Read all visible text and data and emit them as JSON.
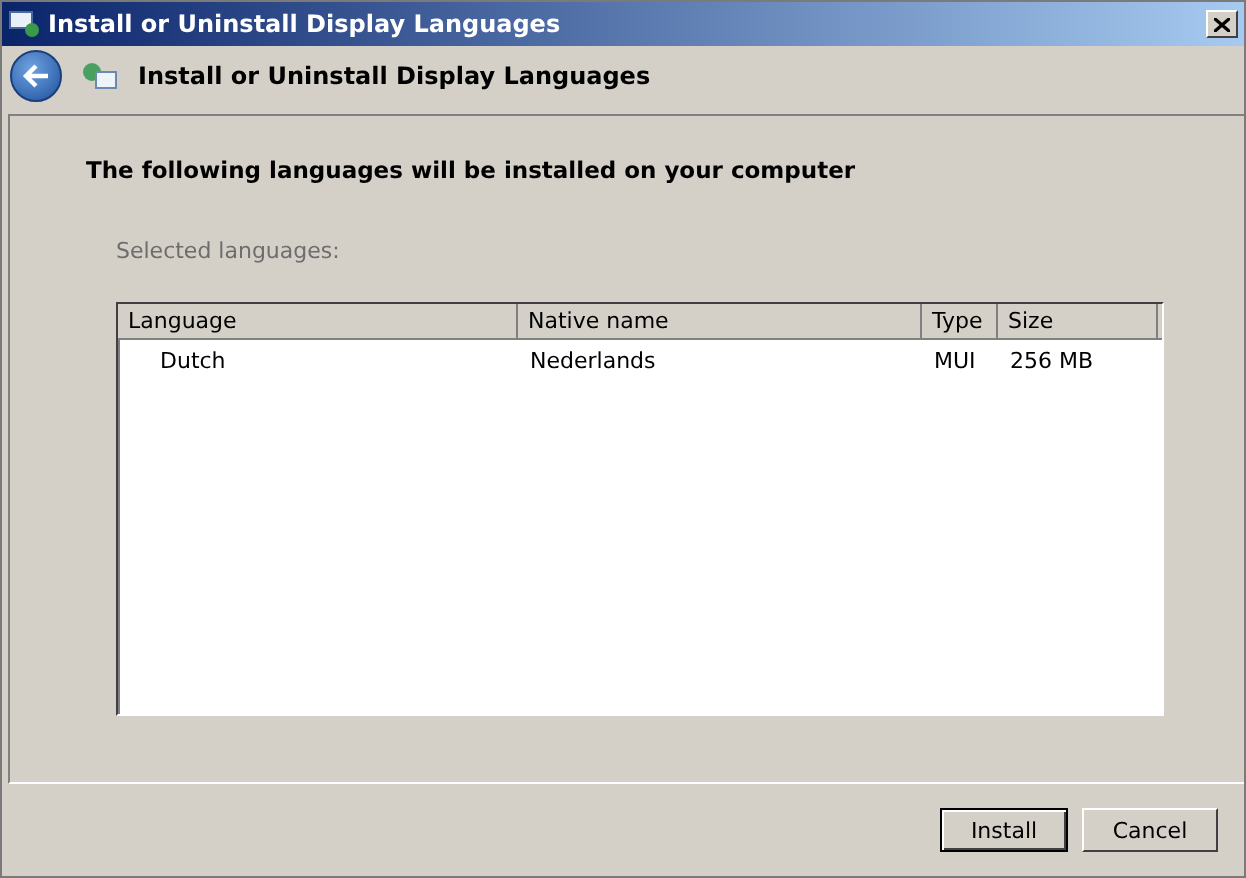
{
  "window": {
    "title": "Install or Uninstall Display Languages"
  },
  "header": {
    "title": "Install or Uninstall Display Languages"
  },
  "heading": "The following languages will be installed on your computer",
  "list_label": "Selected languages:",
  "table": {
    "columns": [
      "Language",
      "Native name",
      "Type",
      "Size"
    ],
    "rows": [
      [
        "Dutch",
        "Nederlands",
        "MUI",
        "256 MB"
      ]
    ]
  },
  "buttons": [
    {
      "label": "Install",
      "default": true
    },
    {
      "label": "Cancel",
      "default": false
    }
  ]
}
